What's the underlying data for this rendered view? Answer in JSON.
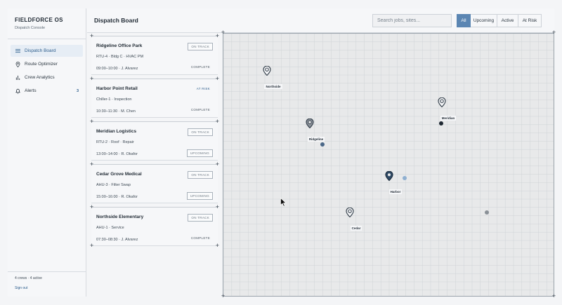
{
  "app": {
    "title": "FIELDFORCE OS",
    "subtitle": "Dispatch Console"
  },
  "sidebar": {
    "items": [
      {
        "label": "Dispatch Board",
        "icon": "list-icon",
        "active": true,
        "count": ""
      },
      {
        "label": "Route Optimizer",
        "icon": "map-pin-icon",
        "active": false,
        "count": ""
      },
      {
        "label": "Crew Analytics",
        "icon": "bar-chart-icon",
        "active": false,
        "count": ""
      },
      {
        "label": "Alerts",
        "icon": "bell-icon",
        "active": false,
        "count": "3"
      }
    ],
    "footer_status": "4 crews · 4 active",
    "sign_out_label": "Sign out"
  },
  "header": {
    "title": "Dispatch Board",
    "search_placeholder": "Search jobs, sites...",
    "filters": [
      "All",
      "Upcoming",
      "Active",
      "At Risk"
    ],
    "active_filter": "All"
  },
  "jobs": [
    {
      "name": "Ridgeline Office Park",
      "desc": "RTU-4 · Bldg C · HVAC PM",
      "time": "09:00–10:00 · J. Alvarez",
      "status": "ON TRACK",
      "phase": "COMPLETE"
    },
    {
      "name": "Harbor Point Retail",
      "desc": "Chiller-1 · Inspection",
      "time": "10:30–11:30 · M. Chen",
      "status": "AT RISK",
      "phase": "COMPLETE"
    },
    {
      "name": "Meridian Logistics",
      "desc": "RTU-2 · Roof · Repair",
      "time": "13:00–14:00 · R. Okafor",
      "status": "ON TRACK",
      "phase": "UPCOMING"
    },
    {
      "name": "Cedar Grove Medical",
      "desc": "AHU-3 · Filter Swap",
      "time": "15:00–16:00 · R. Okafor",
      "status": "ON TRACK",
      "phase": "UPCOMING"
    },
    {
      "name": "Northside Elementary",
      "desc": "AHU-1 · Service",
      "time": "07:30–08:30 · J. Alvarez",
      "status": "ON TRACK",
      "phase": "COMPLETE"
    }
  ],
  "map": {
    "pins": [
      {
        "label": "Northside",
        "style": "outline"
      },
      {
        "label": "Ridgeline",
        "style": "dark"
      },
      {
        "label": "Meridian",
        "style": "outline"
      },
      {
        "label": "Harbor",
        "style": "filled"
      },
      {
        "label": "Cedar",
        "style": "outline"
      }
    ],
    "crew_dots": [
      {
        "color": "#1f2933"
      },
      {
        "color": "#4a6788"
      },
      {
        "color": "#8fb0d1"
      },
      {
        "color": "#8a9097"
      }
    ]
  },
  "colors": {
    "accent": "#5b86b3",
    "brand_blue": "#2c5d8c",
    "grid_line": "#cfd3d7",
    "map_bg": "#e8e9ea"
  }
}
